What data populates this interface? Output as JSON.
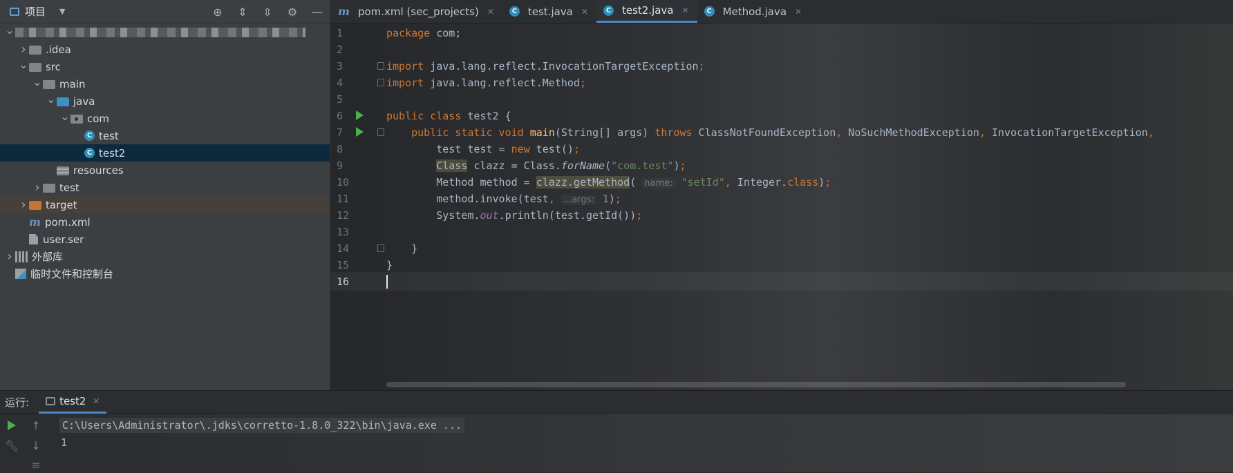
{
  "sidebar": {
    "title": "项目",
    "tree": [
      {
        "label": "",
        "depth": 0,
        "arrow": "open",
        "icon": "module-blurred"
      },
      {
        "label": ".idea",
        "depth": 1,
        "arrow": "closed",
        "icon": "folder"
      },
      {
        "label": "src",
        "depth": 1,
        "arrow": "open",
        "icon": "folder"
      },
      {
        "label": "main",
        "depth": 2,
        "arrow": "open",
        "icon": "folder"
      },
      {
        "label": "java",
        "depth": 3,
        "arrow": "open",
        "icon": "folder-blue"
      },
      {
        "label": "com",
        "depth": 4,
        "arrow": "open",
        "icon": "package"
      },
      {
        "label": "test",
        "depth": 5,
        "arrow": "none",
        "icon": "class"
      },
      {
        "label": "test2",
        "depth": 5,
        "arrow": "none",
        "icon": "class",
        "selected": true
      },
      {
        "label": "resources",
        "depth": 3,
        "arrow": "none",
        "icon": "folder-resources"
      },
      {
        "label": "test",
        "depth": 2,
        "arrow": "closed",
        "icon": "folder"
      },
      {
        "label": "target",
        "depth": 1,
        "arrow": "closed",
        "icon": "folder-orange",
        "highlight": true
      },
      {
        "label": "pom.xml",
        "depth": 1,
        "arrow": "none",
        "icon": "maven"
      },
      {
        "label": "user.ser",
        "depth": 1,
        "arrow": "none",
        "icon": "file"
      },
      {
        "label": "外部库",
        "depth": 0,
        "arrow": "closed",
        "icon": "library"
      },
      {
        "label": "临时文件和控制台",
        "depth": 0,
        "arrow": "none",
        "icon": "scratch"
      }
    ]
  },
  "tabs": [
    {
      "label": "pom.xml (sec_projects)",
      "icon": "maven",
      "active": false
    },
    {
      "label": "test.java",
      "icon": "class",
      "active": false
    },
    {
      "label": "test2.java",
      "icon": "class",
      "active": true
    },
    {
      "label": "Method.java",
      "icon": "class-lib",
      "active": false
    }
  ],
  "code": {
    "line_numbers": [
      "1",
      "2",
      "3",
      "4",
      "5",
      "6",
      "7",
      "8",
      "9",
      "10",
      "11",
      "12",
      "13",
      "14",
      "15",
      "16"
    ],
    "l1_kw": "package",
    "l1_rest": " com;",
    "l3_kw": "import",
    "l3_rest": " java.lang.reflect.InvocationTargetException",
    "semi": ";",
    "l4_kw": "import",
    "l4_rest": " java.lang.reflect.Method",
    "l6_kw": "public class",
    "l6_rest": " test2 {",
    "l7_kw": "public static void",
    "l7_fn": "main",
    "l7_mid": "(String[] args) ",
    "l7_throws": "throws",
    "l7_rest1": " ClassNotFoundException",
    "l7_rest2": " NoSuchMethodException",
    "l7_rest3": " InvocationTargetException",
    "comma": ",",
    "l8_a": "test test = ",
    "l8_kw": "new",
    "l8_b": " test()",
    "l9_class": "Class",
    "l9_a": " clazz = Class.",
    "l9_it": "forName",
    "l9_b": "(",
    "l9_str": "\"com.test\"",
    "l9_c": ")",
    "l10_a": "Method method = ",
    "l10_hl": "clazz.getMethod",
    "l10_b": "( ",
    "l10_hint": "name:",
    "l10_str": "\"setId\"",
    "l10_c": " Integer.",
    "l10_kw": "class",
    "l10_d": ")",
    "l11_a": "method.invoke(test",
    "l11_hint": "...args:",
    "l11_num": "1",
    "l11_b": ")",
    "l12_a": "System.",
    "l12_stat": "out",
    "l12_b": ".println(test.getId())",
    "l14": "}",
    "l15": "}"
  },
  "run": {
    "label": "运行:",
    "tab": "test2",
    "console_cmd": "C:\\Users\\Administrator\\.jdks\\corretto-1.8.0_322\\bin\\java.exe ...",
    "console_out": "1"
  }
}
